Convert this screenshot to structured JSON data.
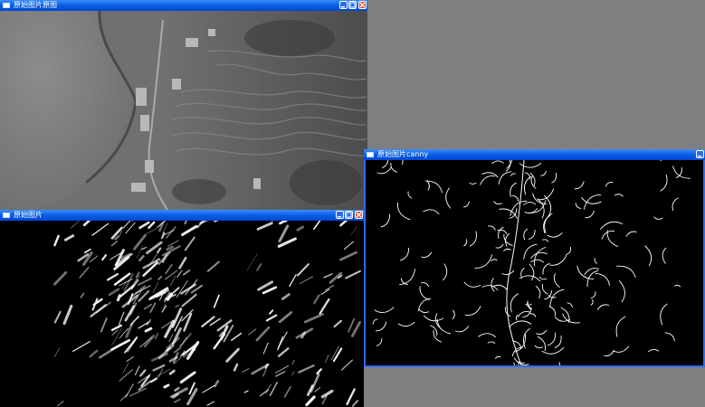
{
  "colors": {
    "desktop": "#7f7f7f",
    "titlebar": "#0a5fe0",
    "titlebar_text": "#ffffff",
    "close_button": "#e0522f"
  },
  "windows": {
    "original": {
      "title": "原始图片原图",
      "content": "grayscale aerial photo of hillside terraces and shoreline"
    },
    "processed": {
      "title": "原始图片",
      "content": "black image with bright white ridge and edge responses"
    },
    "canny": {
      "title": "原始图片canny",
      "content": "black image with thin white canny edge lines"
    }
  },
  "icons": {
    "window_icon": "app-window-icon",
    "minimize": "minimize-icon",
    "maximize": "maximize-icon",
    "close": "close-icon"
  }
}
